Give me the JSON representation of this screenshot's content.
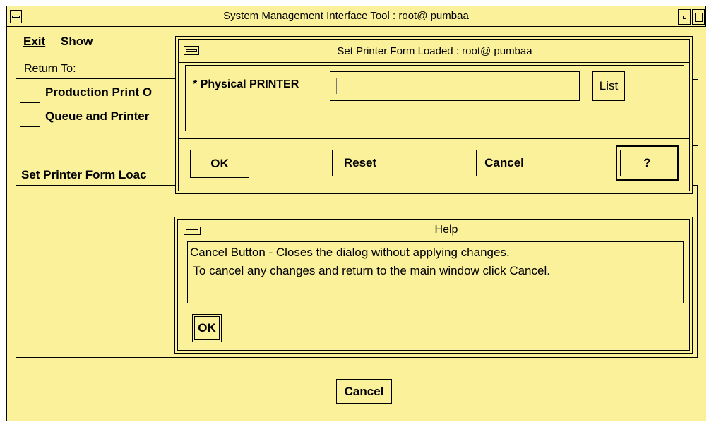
{
  "main_window": {
    "title": "System Management Interface Tool :  root@ pumbaa",
    "menu": [
      {
        "label": "Exit",
        "mnemonic": "E"
      },
      {
        "label": "Show",
        "mnemonic": "S"
      }
    ],
    "return_to_label": "Return To:",
    "return_items": [
      "Production Print O",
      "Queue and Printer"
    ],
    "section_title": "Set Printer Form Loac",
    "cancel_label": "Cancel"
  },
  "form_dialog": {
    "title": "Set Printer Form Loaded :  root@ pumbaa",
    "field_label": "* Physical PRINTER",
    "field_value": "",
    "list_label": "List",
    "ok_label": "OK",
    "reset_label": "Reset",
    "cancel_label": "Cancel",
    "help_label": "?"
  },
  "help_dialog": {
    "title": "Help",
    "line1": "Cancel Button - Closes the dialog without applying changes.",
    "line2": " To cancel any changes and return to the main window click Cancel.",
    "ok_label": "OK"
  },
  "colors": {
    "background": "#fbf19a",
    "border": "#000000"
  }
}
